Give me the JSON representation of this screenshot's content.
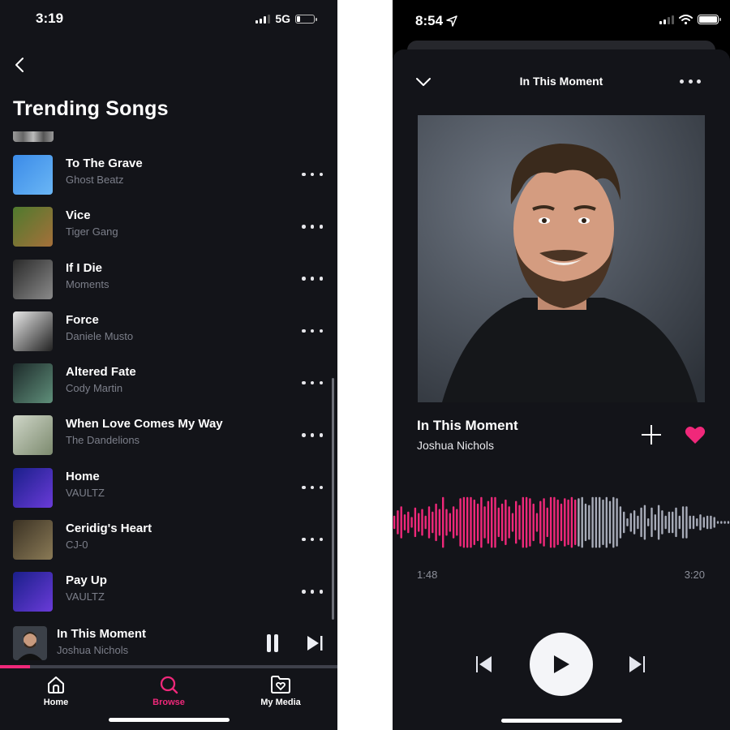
{
  "left_screen": {
    "status_bar": {
      "time": "3:19",
      "network": "5G",
      "battery_level": 0.2
    },
    "page_title": "Trending Songs",
    "songs": [
      {
        "title": "To The Grave",
        "artist": "Ghost Beatz",
        "art_colors": [
          "#3b8be8",
          "#6ab6f5"
        ]
      },
      {
        "title": "Vice",
        "artist": "Tiger Gang",
        "art_colors": [
          "#4f7a2e",
          "#a5703a"
        ]
      },
      {
        "title": "If I Die",
        "artist": "Moments",
        "art_colors": [
          "#2a2a2a",
          "#8a8a8a"
        ]
      },
      {
        "title": "Force",
        "artist": "Daniele Musto",
        "art_colors": [
          "#e8e8e8",
          "#222222"
        ]
      },
      {
        "title": "Altered Fate",
        "artist": "Cody Martin",
        "art_colors": [
          "#1d2a2a",
          "#5f8f7a"
        ]
      },
      {
        "title": "When Love Comes My Way",
        "artist": "The Dandelions",
        "art_colors": [
          "#cfd6c8",
          "#7c8a6e"
        ]
      },
      {
        "title": "Home",
        "artist": "VAULTZ",
        "art_colors": [
          "#1a1f8a",
          "#6a3bd8"
        ]
      },
      {
        "title": "Ceridig's Heart",
        "artist": "CJ-0",
        "art_colors": [
          "#3b3224",
          "#8a7a56"
        ]
      },
      {
        "title": "Pay Up",
        "artist": "VAULTZ",
        "art_colors": [
          "#1a1f8a",
          "#6a3bd8"
        ]
      }
    ],
    "mini_player": {
      "title": "In This Moment",
      "artist": "Joshua Nichols",
      "progress": 0.09,
      "pause_icon": "pause-icon",
      "next_icon": "skip-next-icon"
    },
    "tab_bar": {
      "tabs": [
        {
          "label": "Home",
          "icon": "home-icon",
          "active": false
        },
        {
          "label": "Browse",
          "icon": "search-icon",
          "active": true
        },
        {
          "label": "My Media",
          "icon": "folder-heart-icon",
          "active": false
        }
      ]
    }
  },
  "right_screen": {
    "status_bar": {
      "time": "8:54",
      "location_active": true,
      "battery_level": 1.0
    },
    "header_title": "In This Moment",
    "now_playing": {
      "title": "In This Moment",
      "artist": "Joshua Nichols",
      "liked": true,
      "elapsed": "1:48",
      "total": "3:20",
      "progress": 0.54
    },
    "waveform_amplitudes": [
      0.25,
      0.45,
      0.6,
      0.3,
      0.4,
      0.2,
      0.55,
      0.35,
      0.5,
      0.25,
      0.6,
      0.4,
      0.7,
      0.5,
      0.95,
      0.5,
      0.35,
      0.6,
      0.5,
      0.9,
      0.95,
      0.95,
      0.95,
      0.85,
      0.7,
      0.95,
      0.6,
      0.8,
      0.95,
      0.95,
      0.55,
      0.7,
      0.85,
      0.6,
      0.35,
      0.8,
      0.65,
      0.95,
      0.95,
      0.9,
      0.7,
      0.35,
      0.8,
      0.9,
      0.55,
      0.95,
      0.95,
      0.85,
      0.7,
      0.9,
      0.85,
      0.95,
      0.85,
      0.9,
      0.95,
      0.7,
      0.65,
      0.95,
      0.95,
      0.95,
      0.85,
      0.95,
      0.8,
      0.95,
      0.9,
      0.6,
      0.4,
      0.15,
      0.35,
      0.45,
      0.25,
      0.55,
      0.65,
      0.15,
      0.55,
      0.3,
      0.65,
      0.45,
      0.25,
      0.4,
      0.4,
      0.55,
      0.25,
      0.6,
      0.6,
      0.25,
      0.25,
      0.15,
      0.3,
      0.2,
      0.25,
      0.25,
      0.2,
      0.05,
      0.05,
      0.05,
      0.05
    ],
    "colors": {
      "accent": "#f0287a",
      "played": "#f0287a",
      "unplayed": "#a7abb8"
    }
  }
}
